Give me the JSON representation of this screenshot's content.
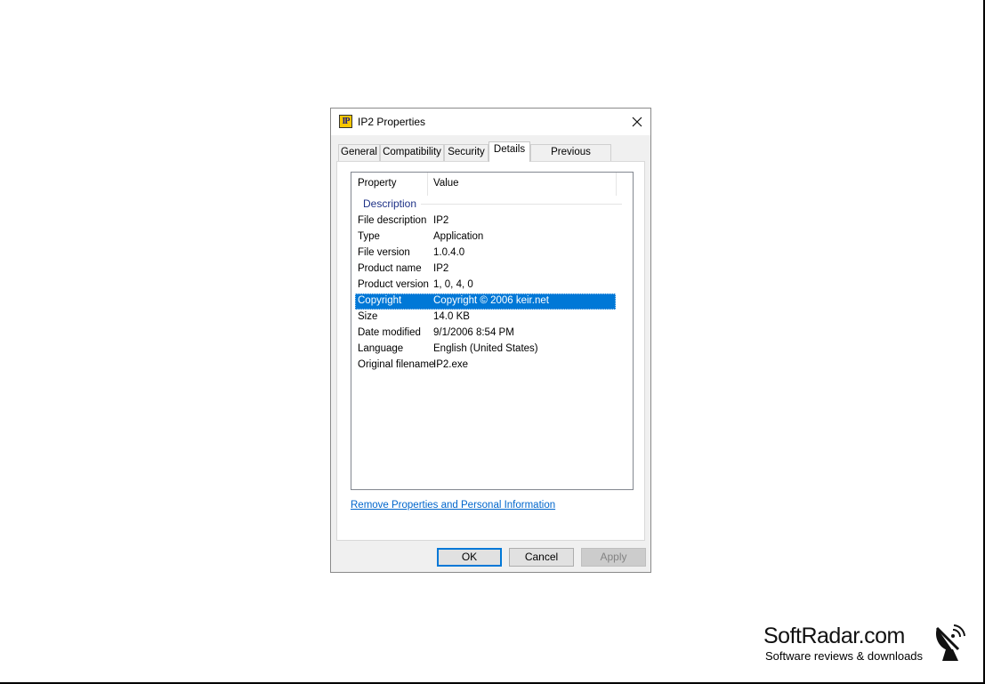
{
  "dialog": {
    "title": "IP2 Properties",
    "icon_label": "IP"
  },
  "tabs": [
    {
      "label": "General",
      "active": false
    },
    {
      "label": "Compatibility",
      "active": false
    },
    {
      "label": "Security",
      "active": false
    },
    {
      "label": "Details",
      "active": true
    },
    {
      "label": "Previous Versions",
      "active": false
    }
  ],
  "details": {
    "columns": {
      "property": "Property",
      "value": "Value"
    },
    "group": "Description",
    "rows": [
      {
        "property": "File description",
        "value": "IP2"
      },
      {
        "property": "Type",
        "value": "Application"
      },
      {
        "property": "File version",
        "value": "1.0.4.0"
      },
      {
        "property": "Product name",
        "value": "IP2"
      },
      {
        "property": "Product version",
        "value": "1, 0, 4, 0"
      },
      {
        "property": "Copyright",
        "value": "Copyright © 2006 keir.net",
        "selected": true
      },
      {
        "property": "Size",
        "value": "14.0 KB"
      },
      {
        "property": "Date modified",
        "value": "9/1/2006 8:54 PM"
      },
      {
        "property": "Language",
        "value": "English (United States)"
      },
      {
        "property": "Original filename",
        "value": "IP2.exe"
      }
    ],
    "remove_link": "Remove Properties and Personal Information"
  },
  "buttons": {
    "ok": "OK",
    "cancel": "Cancel",
    "apply": "Apply"
  },
  "watermark": {
    "site": "SoftRadar.com",
    "tagline": "Software reviews & downloads"
  },
  "colors": {
    "selection": "#0078d7",
    "link": "#0066cc",
    "group_header": "#1e3287"
  }
}
